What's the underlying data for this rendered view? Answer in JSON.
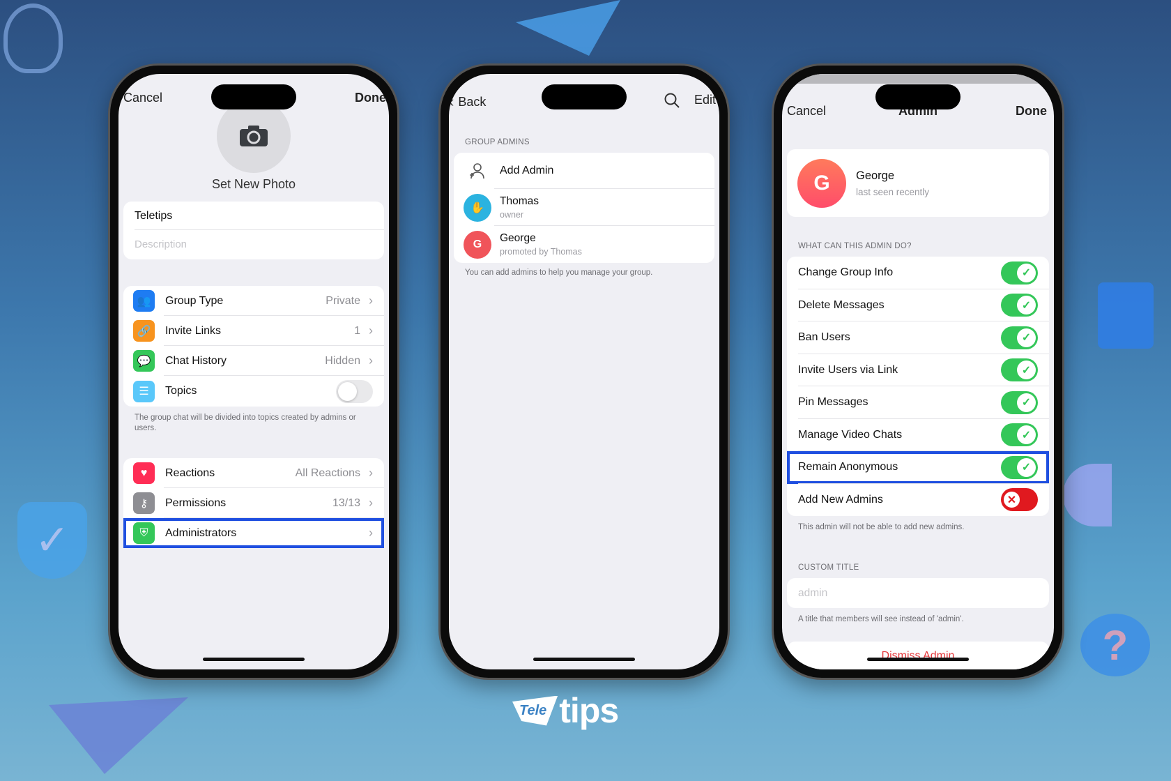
{
  "colors": {
    "accent_highlight": "#1f4fe0",
    "toggle_on": "#34c759",
    "toggle_off_red": "#e0191f",
    "danger": "#e5383b"
  },
  "phone1": {
    "cancel": "Cancel",
    "done": "Done",
    "set_photo": "Set New Photo",
    "name_value": "Teletips",
    "description_placeholder": "Description",
    "settings": [
      {
        "label": "Group Type",
        "value": "Private",
        "icon": "people-icon",
        "color": "#1e7cf2"
      },
      {
        "label": "Invite Links",
        "value": "1",
        "icon": "link-icon",
        "color": "#f7931e"
      },
      {
        "label": "Chat History",
        "value": "Hidden",
        "icon": "chat-bubble-icon",
        "color": "#34c759"
      },
      {
        "label": "Topics",
        "value": "",
        "icon": "list-icon",
        "color": "#5ac8fa",
        "toggle": false
      }
    ],
    "topics_note": "The group chat will be divided into topics created by admins or users.",
    "settings2": [
      {
        "label": "Reactions",
        "value": "All Reactions",
        "icon": "heart-icon",
        "color": "#ff2d55"
      },
      {
        "label": "Permissions",
        "value": "13/13",
        "icon": "key-icon",
        "color": "#8e8e93"
      },
      {
        "label": "Administrators",
        "value": "",
        "icon": "shield-badge-icon",
        "color": "#34c759",
        "highlighted": true
      }
    ]
  },
  "phone2": {
    "back": "Back",
    "edit": "Edit",
    "section": "GROUP ADMINS",
    "add_admin": "Add Admin",
    "admins": [
      {
        "name": "Thomas",
        "sub": "owner",
        "avatar": "hand-emoji",
        "color": "#2bb3e0"
      },
      {
        "name": "George",
        "sub": "promoted by Thomas",
        "avatar": "G",
        "color": "#f0545a"
      }
    ],
    "note": "You can add admins to help you manage your group."
  },
  "phone3": {
    "cancel": "Cancel",
    "title": "Admin",
    "done": "Done",
    "user": {
      "name": "George",
      "status": "last seen recently",
      "initial": "G"
    },
    "section": "WHAT CAN THIS ADMIN DO?",
    "permissions": [
      {
        "label": "Change Group Info",
        "on": true
      },
      {
        "label": "Delete Messages",
        "on": true
      },
      {
        "label": "Ban Users",
        "on": true
      },
      {
        "label": "Invite Users via Link",
        "on": true
      },
      {
        "label": "Pin Messages",
        "on": true
      },
      {
        "label": "Manage Video Chats",
        "on": true
      },
      {
        "label": "Remain Anonymous",
        "on": true,
        "highlighted": true
      },
      {
        "label": "Add New Admins",
        "on": false
      }
    ],
    "perm_note": "This admin will not be able to add new admins.",
    "custom_title_header": "CUSTOM TITLE",
    "custom_title_placeholder": "admin",
    "custom_title_note": "A title that members will see instead of 'admin'.",
    "dismiss": "Dismiss Admin"
  },
  "logo": {
    "tele": "Tele",
    "tips": "tips"
  }
}
